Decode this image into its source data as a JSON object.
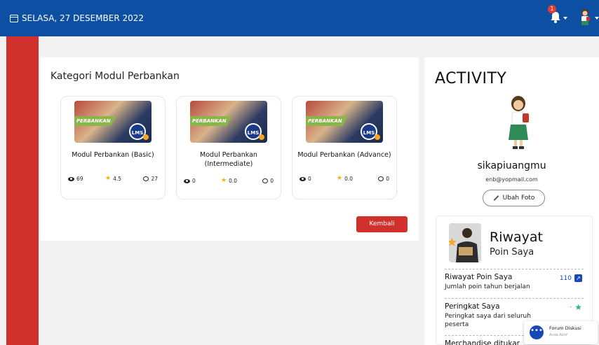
{
  "header": {
    "date": "SELASA, 27 DESEMBER 2022",
    "notif_count": "1"
  },
  "main": {
    "title": "Kategori Modul Perbankan",
    "modules": [
      {
        "thumb_label": "PERBANKAN",
        "badge": "LMS",
        "name": "Modul Perbankan (Basic)",
        "views": "69",
        "rating": "4.5",
        "comments": "27"
      },
      {
        "thumb_label": "PERBANKAN",
        "badge": "LMS",
        "name": "Modul Perbankan (Intermediate)",
        "views": "0",
        "rating": "0.0",
        "comments": "0"
      },
      {
        "thumb_label": "PERBANKAN",
        "badge": "LMS",
        "name": "Modul Perbankan (Advance)",
        "views": "0",
        "rating": "0.0",
        "comments": "0"
      }
    ],
    "back_button": "Kembali"
  },
  "activity": {
    "heading": "ACTIVITY",
    "username": "sikapiuangmu",
    "email": "enb@yopmail.com",
    "edit_photo": "Ubah Foto",
    "riwayat": {
      "title": "Riwayat",
      "subtitle": "Poin Saya",
      "rows": [
        {
          "title": "Riwayat Poin Saya",
          "desc": "Jumlah poin tahun berjalan",
          "value": "110"
        },
        {
          "title": "Peringkat Saya",
          "desc": "Peringkat saya dari seluruh peserta",
          "value": "-"
        },
        {
          "title": "Merchandise ditukar",
          "desc": "",
          "value": ""
        }
      ]
    }
  },
  "forum": {
    "title": "Forum Diskusi",
    "subtitle": "Anda Aktif"
  },
  "colors": {
    "header_blue": "#0d4fa3",
    "accent_red": "#d0312d",
    "link_blue": "#1a47b8"
  }
}
